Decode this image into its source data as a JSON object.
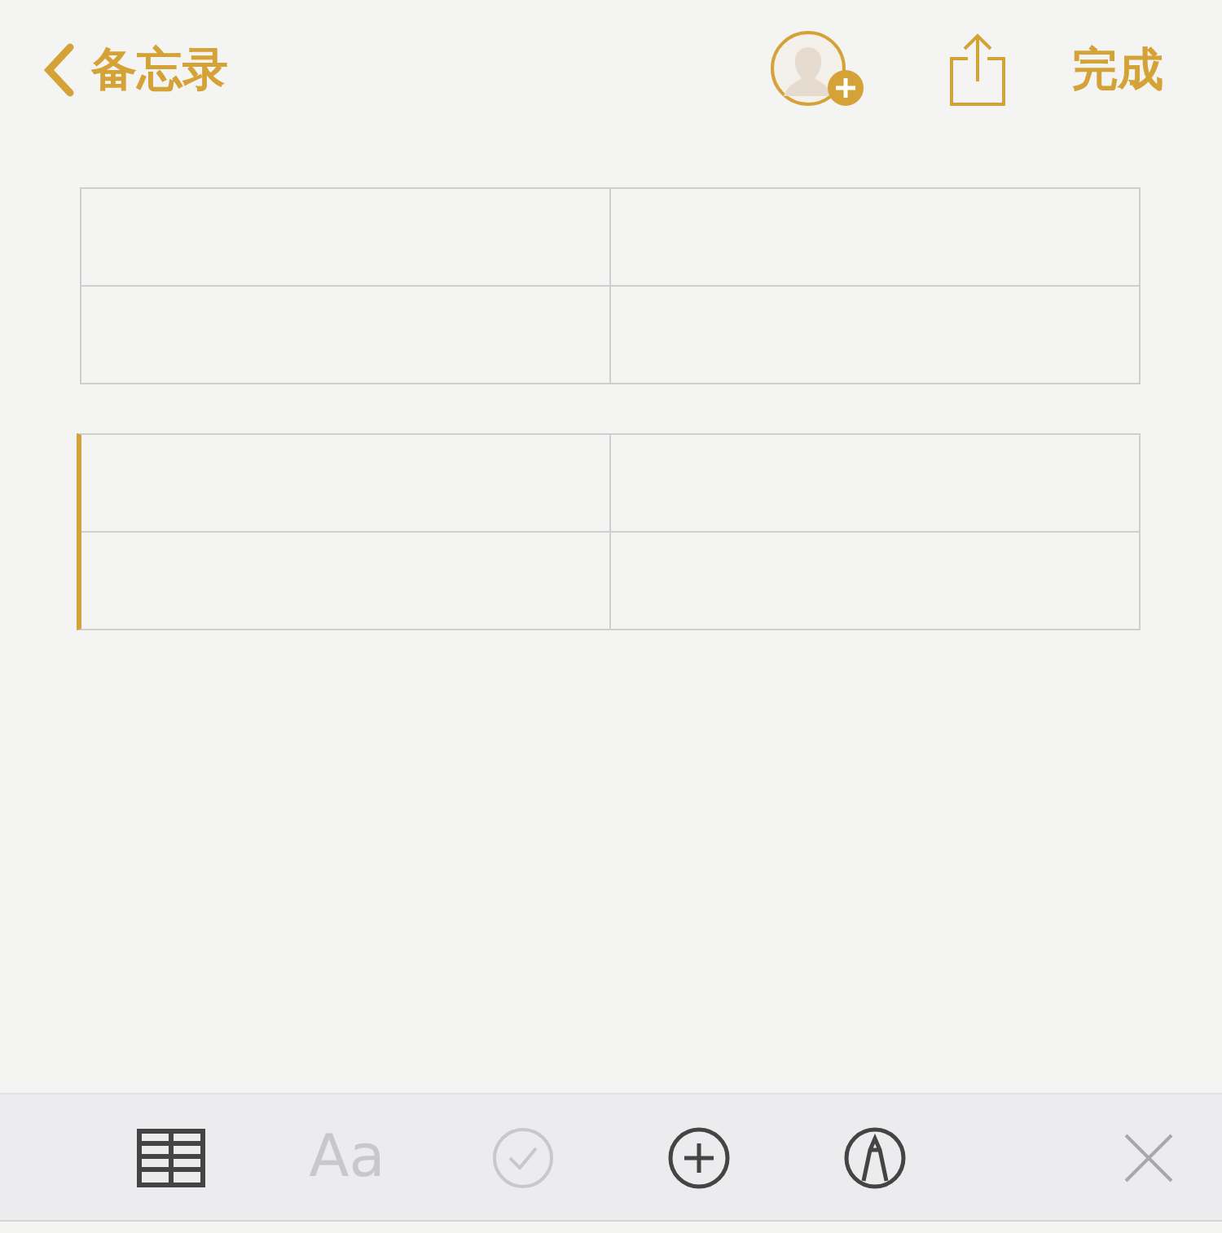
{
  "nav": {
    "back_label": "备忘录",
    "done_label": "完成"
  },
  "tables": [
    {
      "selected": false
    },
    {
      "selected": true
    }
  ],
  "toolbar": [
    {
      "kind": "table",
      "disabled": false
    },
    {
      "kind": "format",
      "label": "Aa",
      "disabled": true
    },
    {
      "kind": "checklist",
      "disabled": true
    },
    {
      "kind": "add",
      "disabled": false
    },
    {
      "kind": "markup",
      "disabled": false
    },
    {
      "kind": "close",
      "disabled": false
    }
  ]
}
